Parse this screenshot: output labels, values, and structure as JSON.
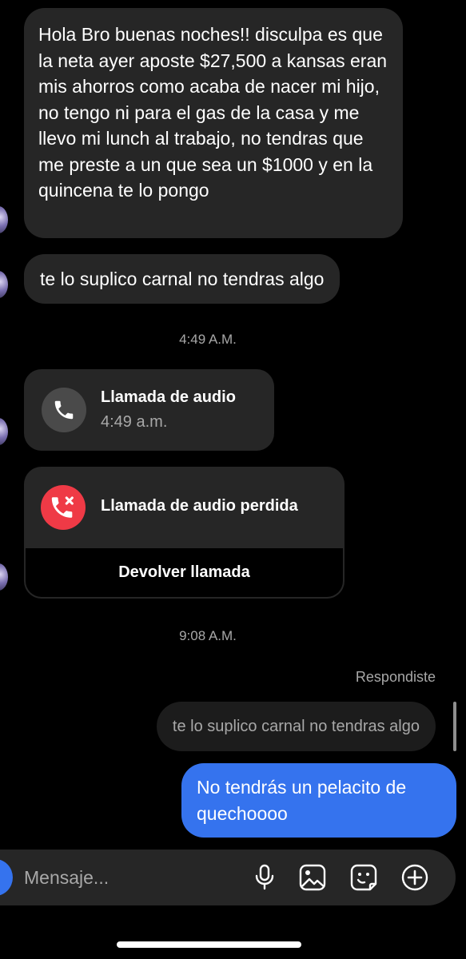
{
  "thread": {
    "incoming_message_1": "Hola Bro buenas noches!! disculpa es que la neta ayer aposte $27,500 a kansas eran mis ahorros como acaba de nacer mi hijo, no tengo ni para el gas de la casa y me llevo mi lunch al trabajo, no tendras que me preste a un que sea un $1000 y en la quincena te lo pongo",
    "incoming_message_2": "te lo suplico carnal no tendras algo",
    "timestamp_1": "4:49 A.M.",
    "audio_call": {
      "title": "Llamada de audio",
      "time": "4:49 a.m."
    },
    "missed_call": {
      "title": "Llamada de audio perdida",
      "action": "Devolver llamada"
    },
    "timestamp_2": "9:08 A.M.",
    "reply_label": "Respondiste",
    "quoted_message": "te lo suplico carnal no tendras algo",
    "outgoing_message": "No tendrás un pelacito de quechoooo"
  },
  "composer": {
    "placeholder": "Mensaje...",
    "icons": [
      "microphone-icon",
      "gallery-icon",
      "sticker-icon",
      "plus-icon"
    ]
  },
  "colors": {
    "background": "#000000",
    "incoming_bubble": "#262626",
    "outgoing_bubble": "#3573ee",
    "missed_call_red": "#ef3a46",
    "secondary_text": "#a8a8a8"
  }
}
